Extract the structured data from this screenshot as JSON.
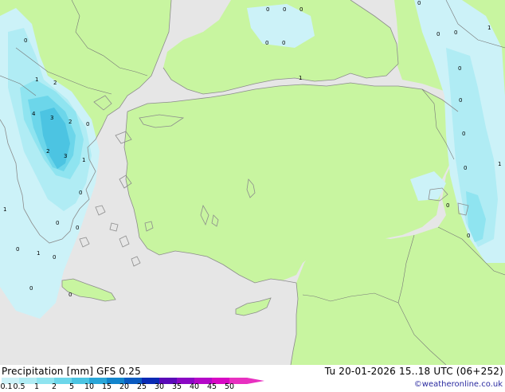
{
  "title": {
    "left": "Precipitation [mm]  GFS 0.25",
    "right": "Tu 20-01-2026 15..18 UTC (06+252)"
  },
  "credit": "©weatheronline.co.uk",
  "legend": {
    "ticks": [
      "0.1",
      "0.5",
      "1",
      "2",
      "5",
      "10",
      "15",
      "20",
      "25",
      "30",
      "35",
      "40",
      "45",
      "50"
    ],
    "colors": [
      "#ccf2f8",
      "#b0ecf4",
      "#8fe4f0",
      "#6cd6ea",
      "#4cc4e2",
      "#2aa6d8",
      "#1284cc",
      "#0a5ac0",
      "#0a2ab4",
      "#5a0ab8",
      "#8a08c4",
      "#b408c8",
      "#d808c4",
      "#e830c0"
    ]
  },
  "colors": {
    "land": "#c8f5a0",
    "sea": "#e6e6e6",
    "coast": "#8c8c8c",
    "border": "#777777"
  },
  "precip_labels": [
    "0",
    "0",
    "0",
    "0",
    "0",
    "0",
    "1",
    "1",
    "0",
    "0",
    "1",
    "2",
    "4",
    "3",
    "2",
    "0",
    "2",
    "3",
    "1",
    "0",
    "0",
    "0",
    "0",
    "0",
    "0",
    "0",
    "0",
    "0",
    "0",
    "1",
    "0",
    "1",
    "1",
    "0",
    "0",
    "0"
  ]
}
